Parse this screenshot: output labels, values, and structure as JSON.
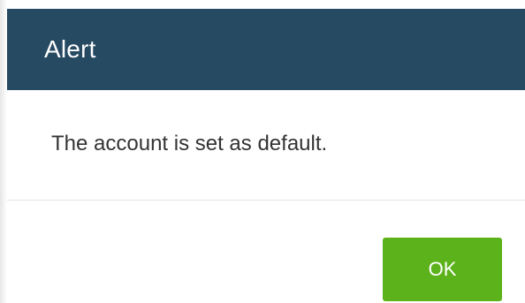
{
  "dialog": {
    "title": "Alert",
    "message": "The account is set as default.",
    "ok_label": "OK",
    "colors": {
      "header_background": "#274a63",
      "header_text": "#ffffff",
      "message_text": "#333333",
      "ok_button_background": "#5cb21b",
      "ok_button_text": "#ffffff"
    }
  }
}
